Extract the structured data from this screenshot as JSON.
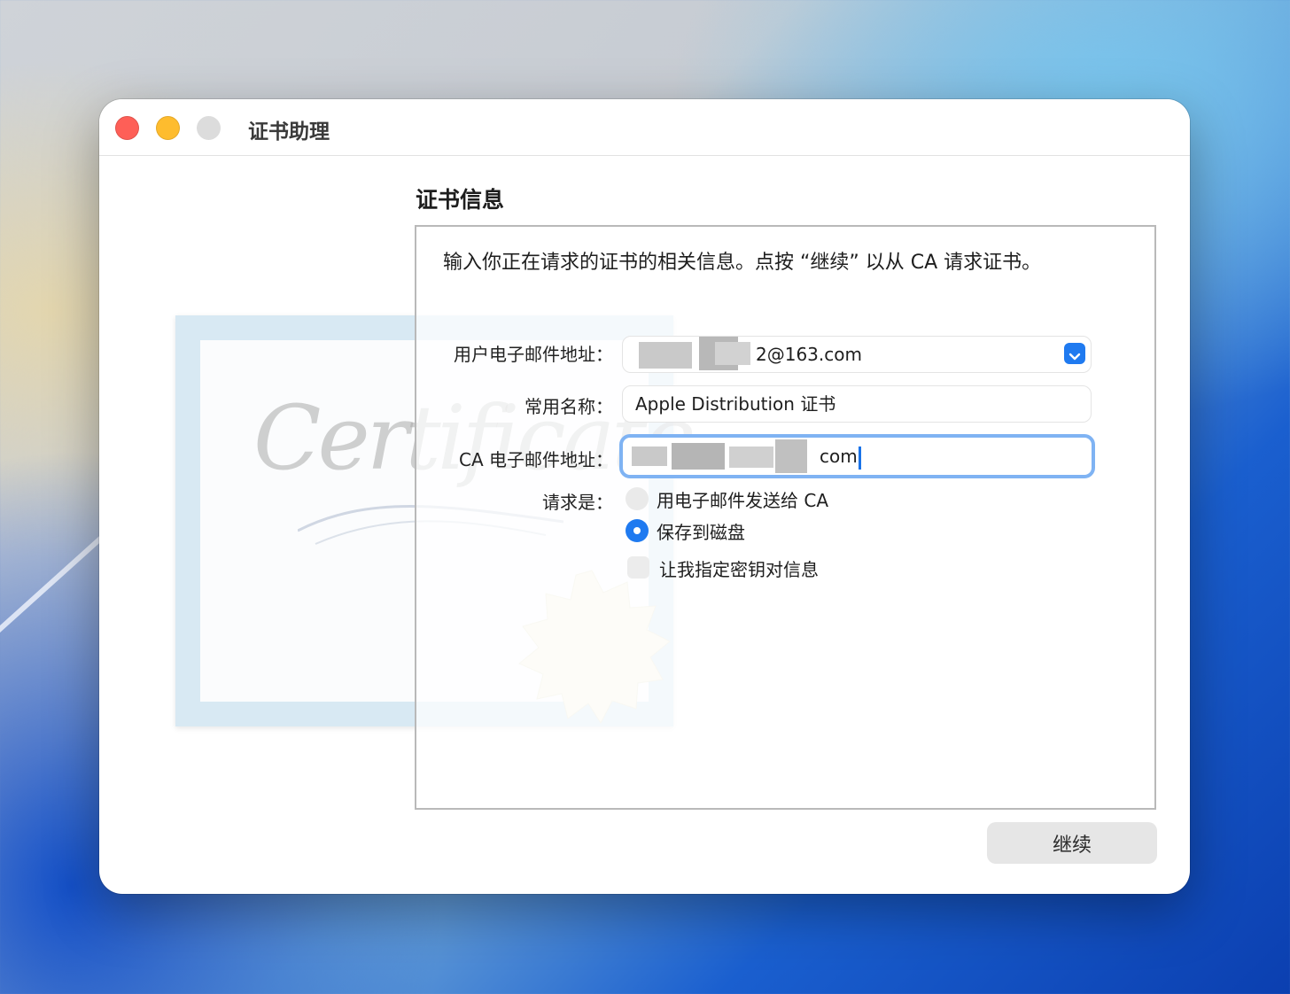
{
  "window": {
    "title": "证书助理"
  },
  "section_title": "证书信息",
  "intro_text": "输入你正在请求的证书的相关信息。点按 “继续” 以从 CA 请求证书。",
  "illustration": {
    "word": "Certificate"
  },
  "form": {
    "user_email": {
      "label": "用户电子邮件地址：",
      "value_visible_suffix": "2@163.com"
    },
    "common_name": {
      "label": "常用名称：",
      "value": "Apple Distribution 证书"
    },
    "ca_email": {
      "label": "CA 电子邮件地址：",
      "value_visible_suffix": "com"
    },
    "request": {
      "label": "请求是：",
      "options": [
        {
          "label": "用电子邮件发送给 CA",
          "selected": false
        },
        {
          "label": "保存到磁盘",
          "selected": true
        }
      ]
    },
    "key_pair_checkbox": {
      "label": "让我指定密钥对信息",
      "checked": false
    }
  },
  "buttons": {
    "continue": "继续"
  },
  "colors": {
    "accent": "#1f7af0",
    "focus_ring": "#7fb3f3",
    "close": "#fe5f57",
    "minimize": "#febc2e",
    "maximize_inactive": "#dcdcdc"
  }
}
